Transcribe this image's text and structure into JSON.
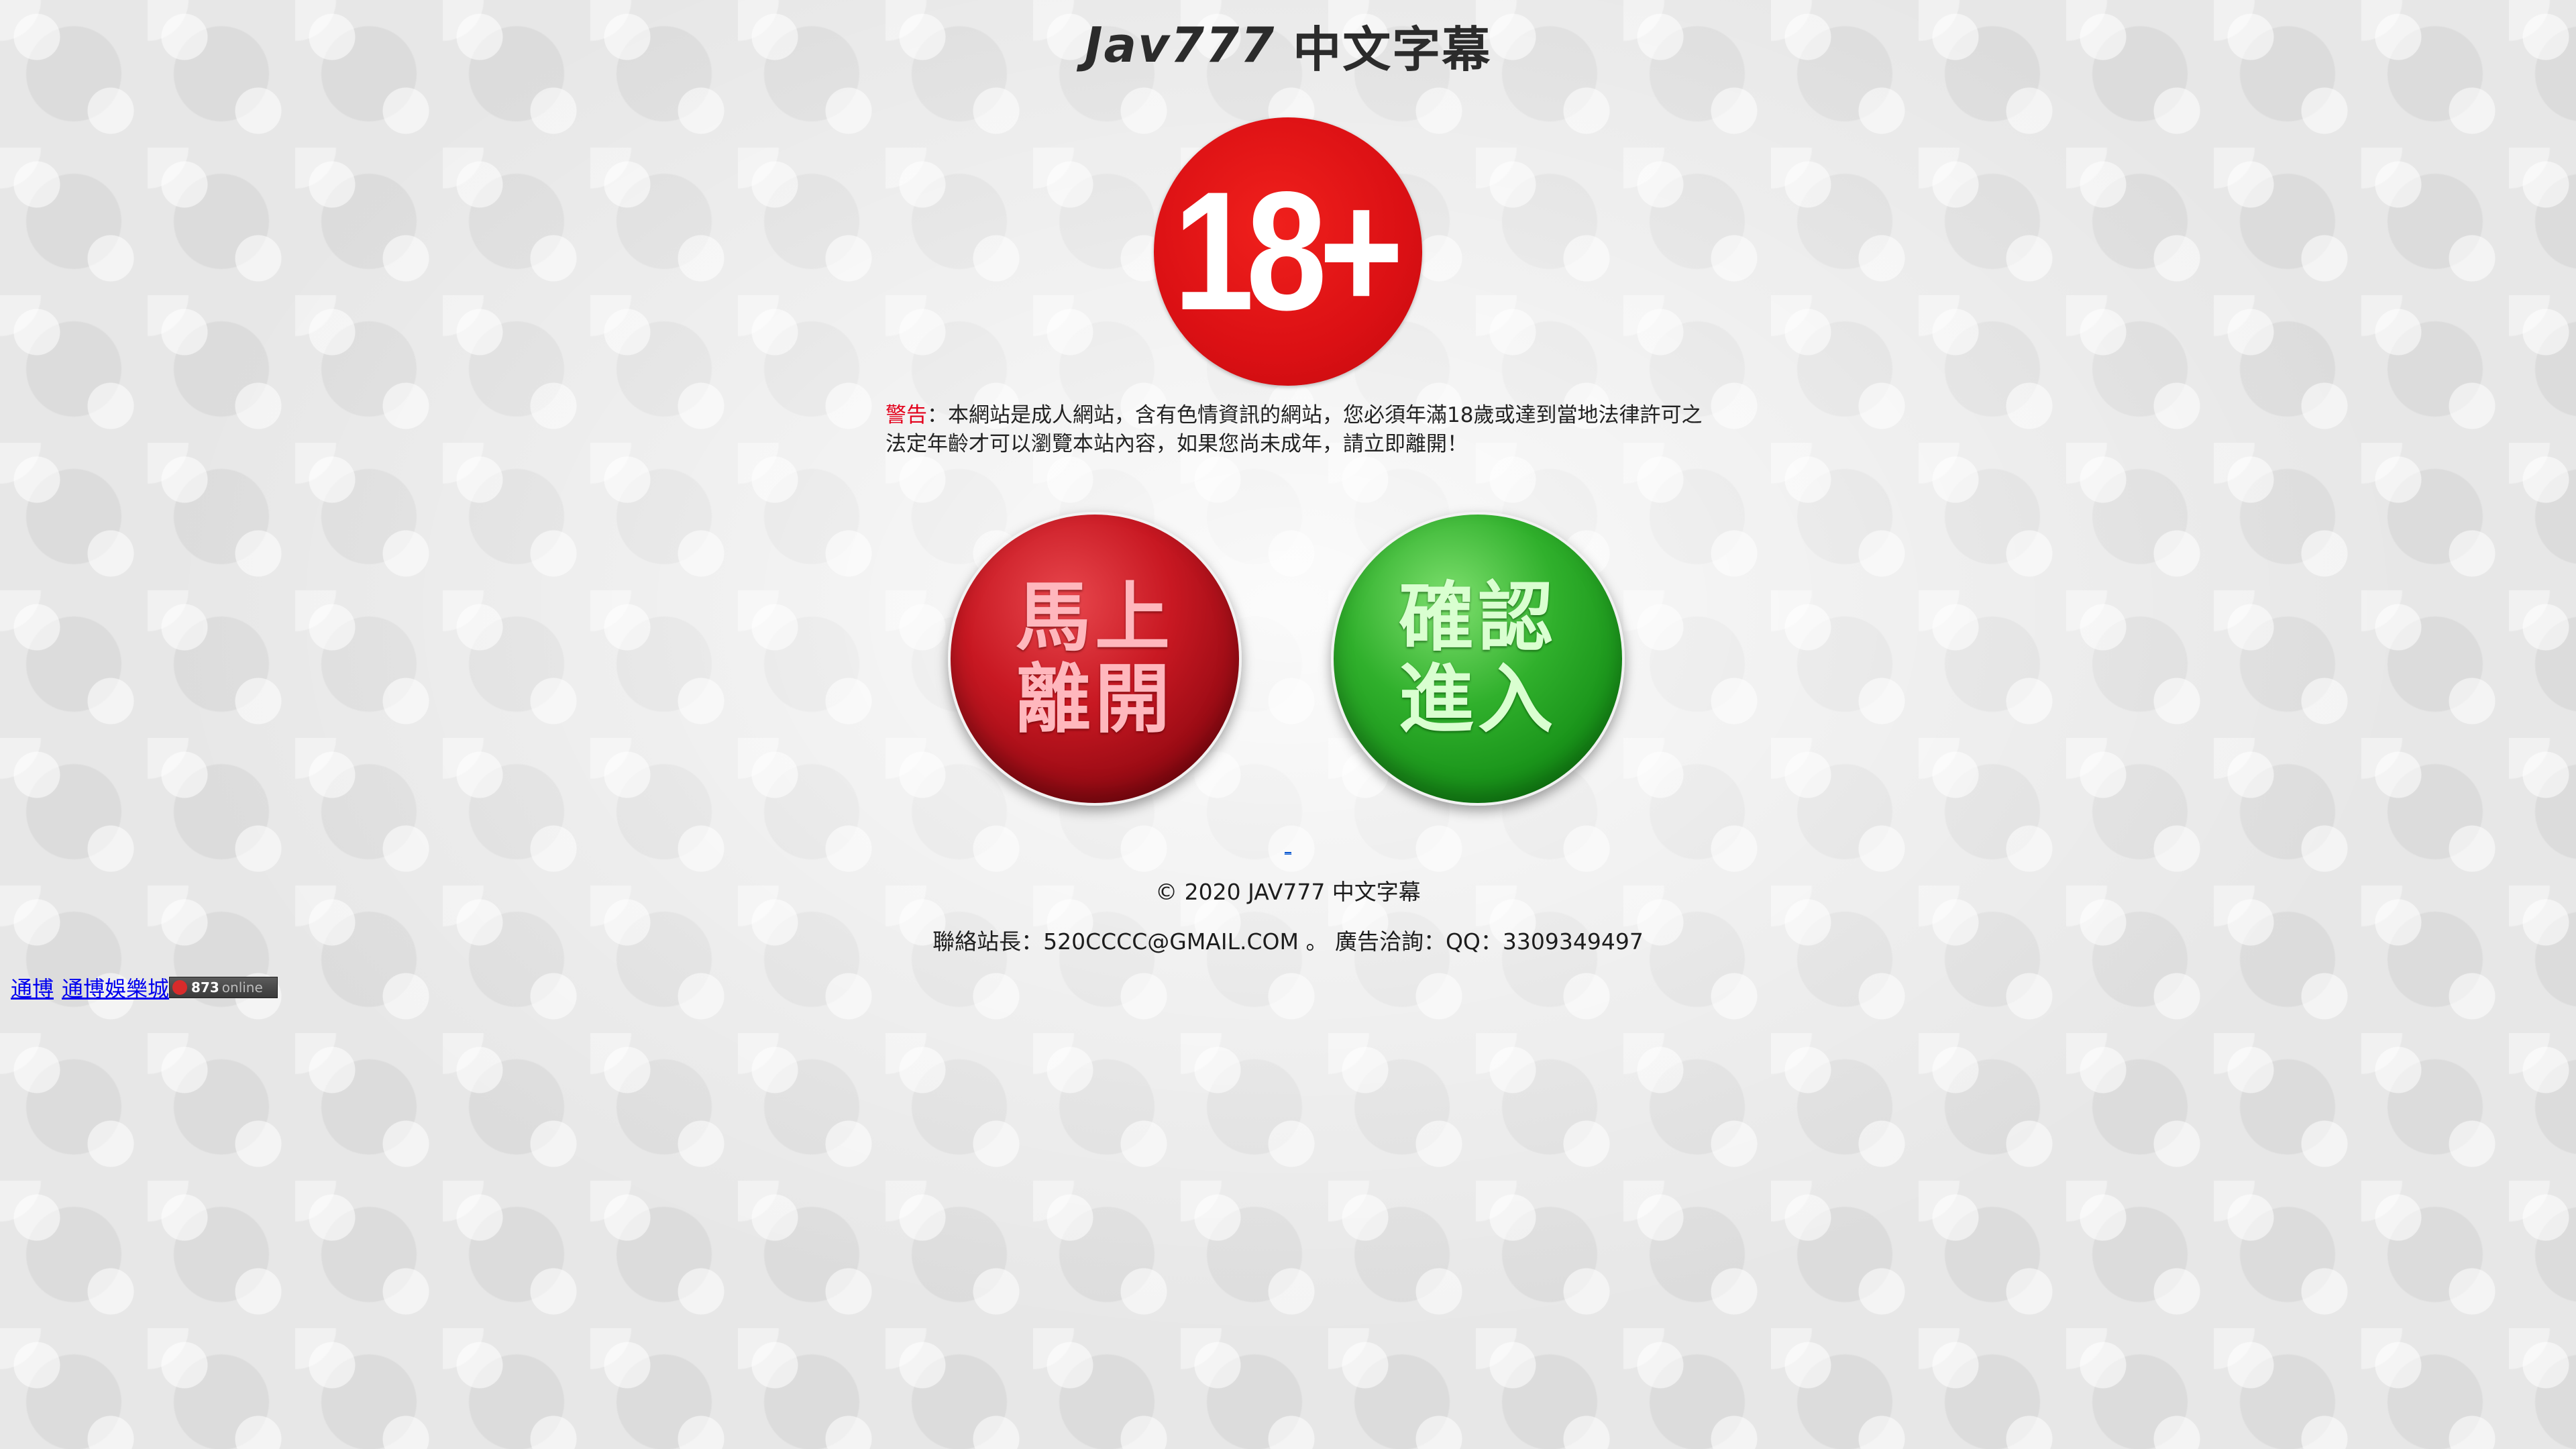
{
  "header": {
    "brand": "Jav777",
    "subtitle": "中文字幕"
  },
  "badge": {
    "label": "18+"
  },
  "warning": {
    "label": "警告",
    "text": "：本網站是成人網站，含有色情資訊的網站，您必須年滿18歲或達到當地法律許可之法定年齡才可以瀏覽本站內容，如果您尚未成年，請立即離開！"
  },
  "buttons": {
    "leave_line1": "馬上",
    "leave_line2": "離開",
    "enter_line1": "確認",
    "enter_line2": "進入"
  },
  "footer": {
    "tiny_link": "_",
    "copyright": "© 2020 JAV777 中文字幕",
    "contact": "聯絡站長：520CCCC@GMAIL.COM 。 廣告洽詢：QQ：3309349497"
  },
  "links": {
    "link1": "通博",
    "link2": "通博娛樂城"
  },
  "online_badge": {
    "count": "873",
    "suffix": "online"
  },
  "colors": {
    "warning_label": "#e3001b",
    "badge_red": "#db1014",
    "leave_red": "#c81822",
    "enter_green": "#30b02c",
    "link_blue": "#0000ee"
  }
}
